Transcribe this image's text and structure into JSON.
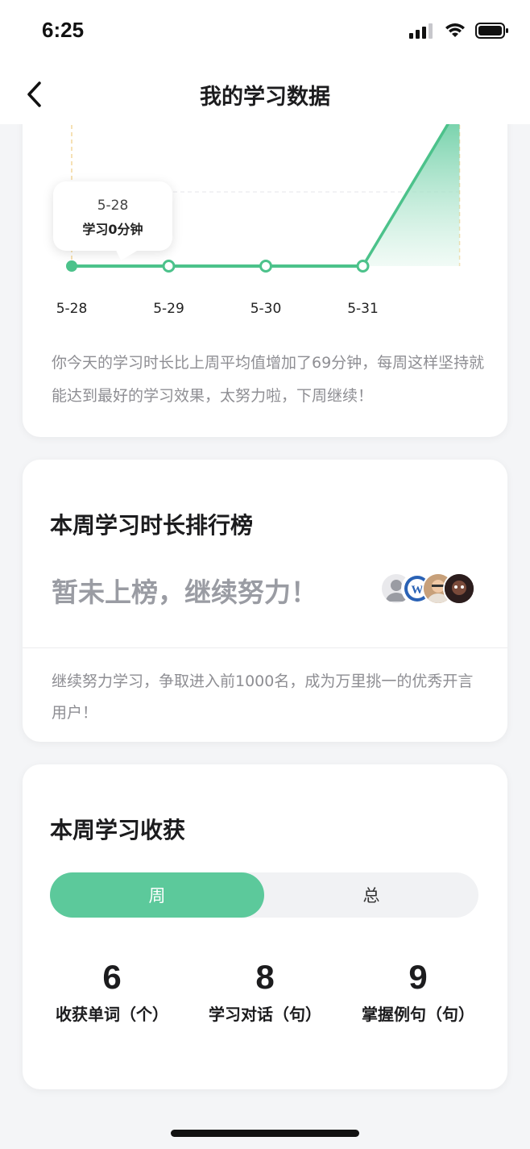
{
  "status_bar": {
    "time": "6:25"
  },
  "nav": {
    "title": "我的学习数据"
  },
  "chart_data": {
    "type": "area",
    "categories": [
      "5-28",
      "5-29",
      "5-30",
      "5-31"
    ],
    "values": [
      0,
      0,
      0,
      0
    ],
    "title": "",
    "xlabel": "",
    "ylabel": "",
    "tooltip": {
      "date": "5-28",
      "text": "学习0分钟"
    },
    "colors": {
      "line": "#4cc28b",
      "fill_top": "#5cc99b",
      "fill_bottom": "#e8f8f0",
      "guide": "#f3d79c"
    }
  },
  "chart_card": {
    "description": "你今天的学习时长比上周平均值增加了69分钟，每周这样坚持就能达到最好的学习效果，太努力啦，下周继续！"
  },
  "rank_card": {
    "title": "本周学习时长排行榜",
    "status": "暂未上榜，继续努力！",
    "description": "继续努力学习，争取进入前1000名，成为万里挑一的优秀开言用户！",
    "avatars": [
      "user-avatar-1",
      "user-avatar-2",
      "user-avatar-3",
      "user-avatar-4"
    ]
  },
  "harvest_card": {
    "title": "本周学习收获",
    "tabs": {
      "week": "周",
      "total": "总",
      "selected": "周"
    },
    "stats": [
      {
        "value": "6",
        "label": "收获单词（个）"
      },
      {
        "value": "8",
        "label": "学习对话（句）"
      },
      {
        "value": "9",
        "label": "掌握例句（句）"
      }
    ]
  },
  "colors": {
    "accent": "#5cc99b",
    "text_muted": "#8e8e93"
  }
}
